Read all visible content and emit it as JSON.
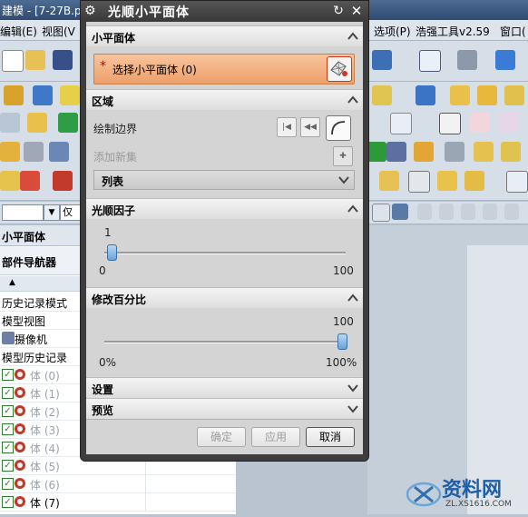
{
  "app": {
    "title_fragment": "建模 - [7-27B.prt",
    "menu_left": [
      "编辑(E)",
      "视图(V"
    ],
    "menu_right": [
      "选项(P)",
      "浩强工具v2.59",
      "窗口("
    ],
    "filter_fragment": "仅"
  },
  "navigator": {
    "header": "小平面体",
    "title": "部件导航器",
    "rows": [
      {
        "label": "历史记录模式"
      },
      {
        "label": "模型视图"
      },
      {
        "label": "摄像机"
      },
      {
        "label": "模型历史记录"
      },
      {
        "label": "体 (0)"
      },
      {
        "label": "体 (1)"
      },
      {
        "label": "体 (2)"
      },
      {
        "label": "体 (3)"
      },
      {
        "label": "体 (4)"
      },
      {
        "label": "体 (5)"
      },
      {
        "label": "体 (6)"
      },
      {
        "label": "体 (7)"
      }
    ]
  },
  "dialog": {
    "title": "光顺小平面体",
    "sections": {
      "facet_body": {
        "title": "小平面体",
        "select_label": "选择小平面体 (0)"
      },
      "region": {
        "title": "区域",
        "draw_boundary": "绘制边界",
        "add_new_set": "添加新集",
        "list": "列表"
      },
      "smoothing_factor": {
        "title": "光顺因子",
        "value": "1",
        "min": "0",
        "max": "100",
        "fraction": 0.01
      },
      "modify_percent": {
        "title": "修改百分比",
        "value": "100",
        "min": "0%",
        "max": "100%",
        "fraction": 1.0
      },
      "settings": {
        "title": "设置"
      },
      "preview": {
        "title": "预览"
      }
    },
    "buttons": {
      "ok": "确定",
      "apply": "应用",
      "cancel": "取消"
    }
  },
  "watermark": {
    "brand": "资料网",
    "url": "ZL.XS1616.COM"
  },
  "colors": {
    "selection_highlight": "#eda06a",
    "required_star": "#d10000",
    "slider_thumb": "#6aa3d8"
  }
}
